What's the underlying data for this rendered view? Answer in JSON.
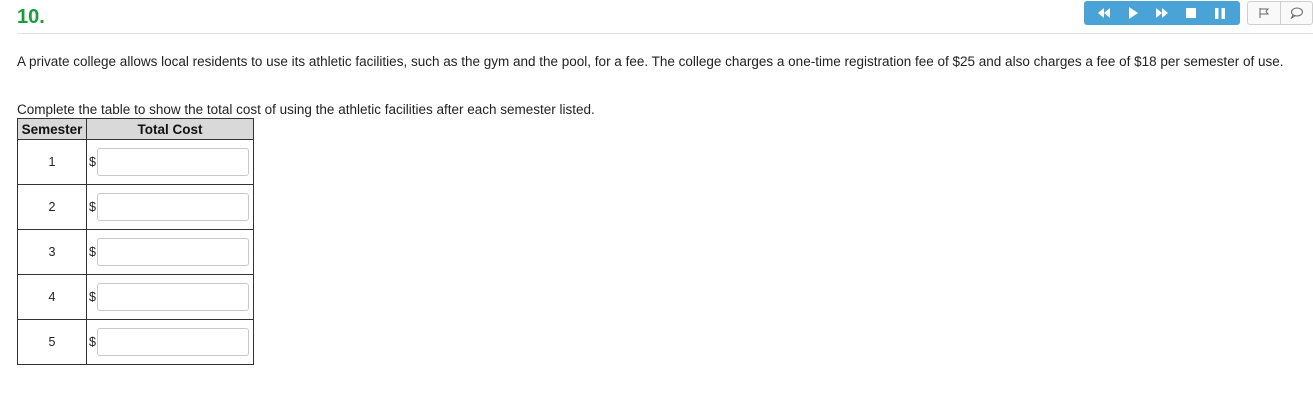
{
  "question": {
    "number": "10.",
    "prompt": "A private college allows local residents to use its athletic facilities, such as the gym and the pool, for a fee. The college charges a one-time registration fee of $25 and also charges a fee of $18 per semester of use.",
    "instruction": "Complete the table to show the total cost of using the athletic facilities after each semester listed."
  },
  "colors": {
    "accent_green": "#1a9c3e",
    "player_blue": "#4aa3d6"
  },
  "player": {
    "icons": [
      "rewind-icon",
      "play-icon",
      "fast-forward-icon",
      "stop-icon",
      "pause-icon"
    ]
  },
  "tools": {
    "icons": [
      "flag-icon",
      "comment-icon"
    ]
  },
  "table": {
    "headers": [
      "Semester",
      "Total Cost"
    ],
    "currency": "$",
    "rows": [
      {
        "semester": "1",
        "value": ""
      },
      {
        "semester": "2",
        "value": ""
      },
      {
        "semester": "3",
        "value": ""
      },
      {
        "semester": "4",
        "value": ""
      },
      {
        "semester": "5",
        "value": ""
      }
    ]
  }
}
